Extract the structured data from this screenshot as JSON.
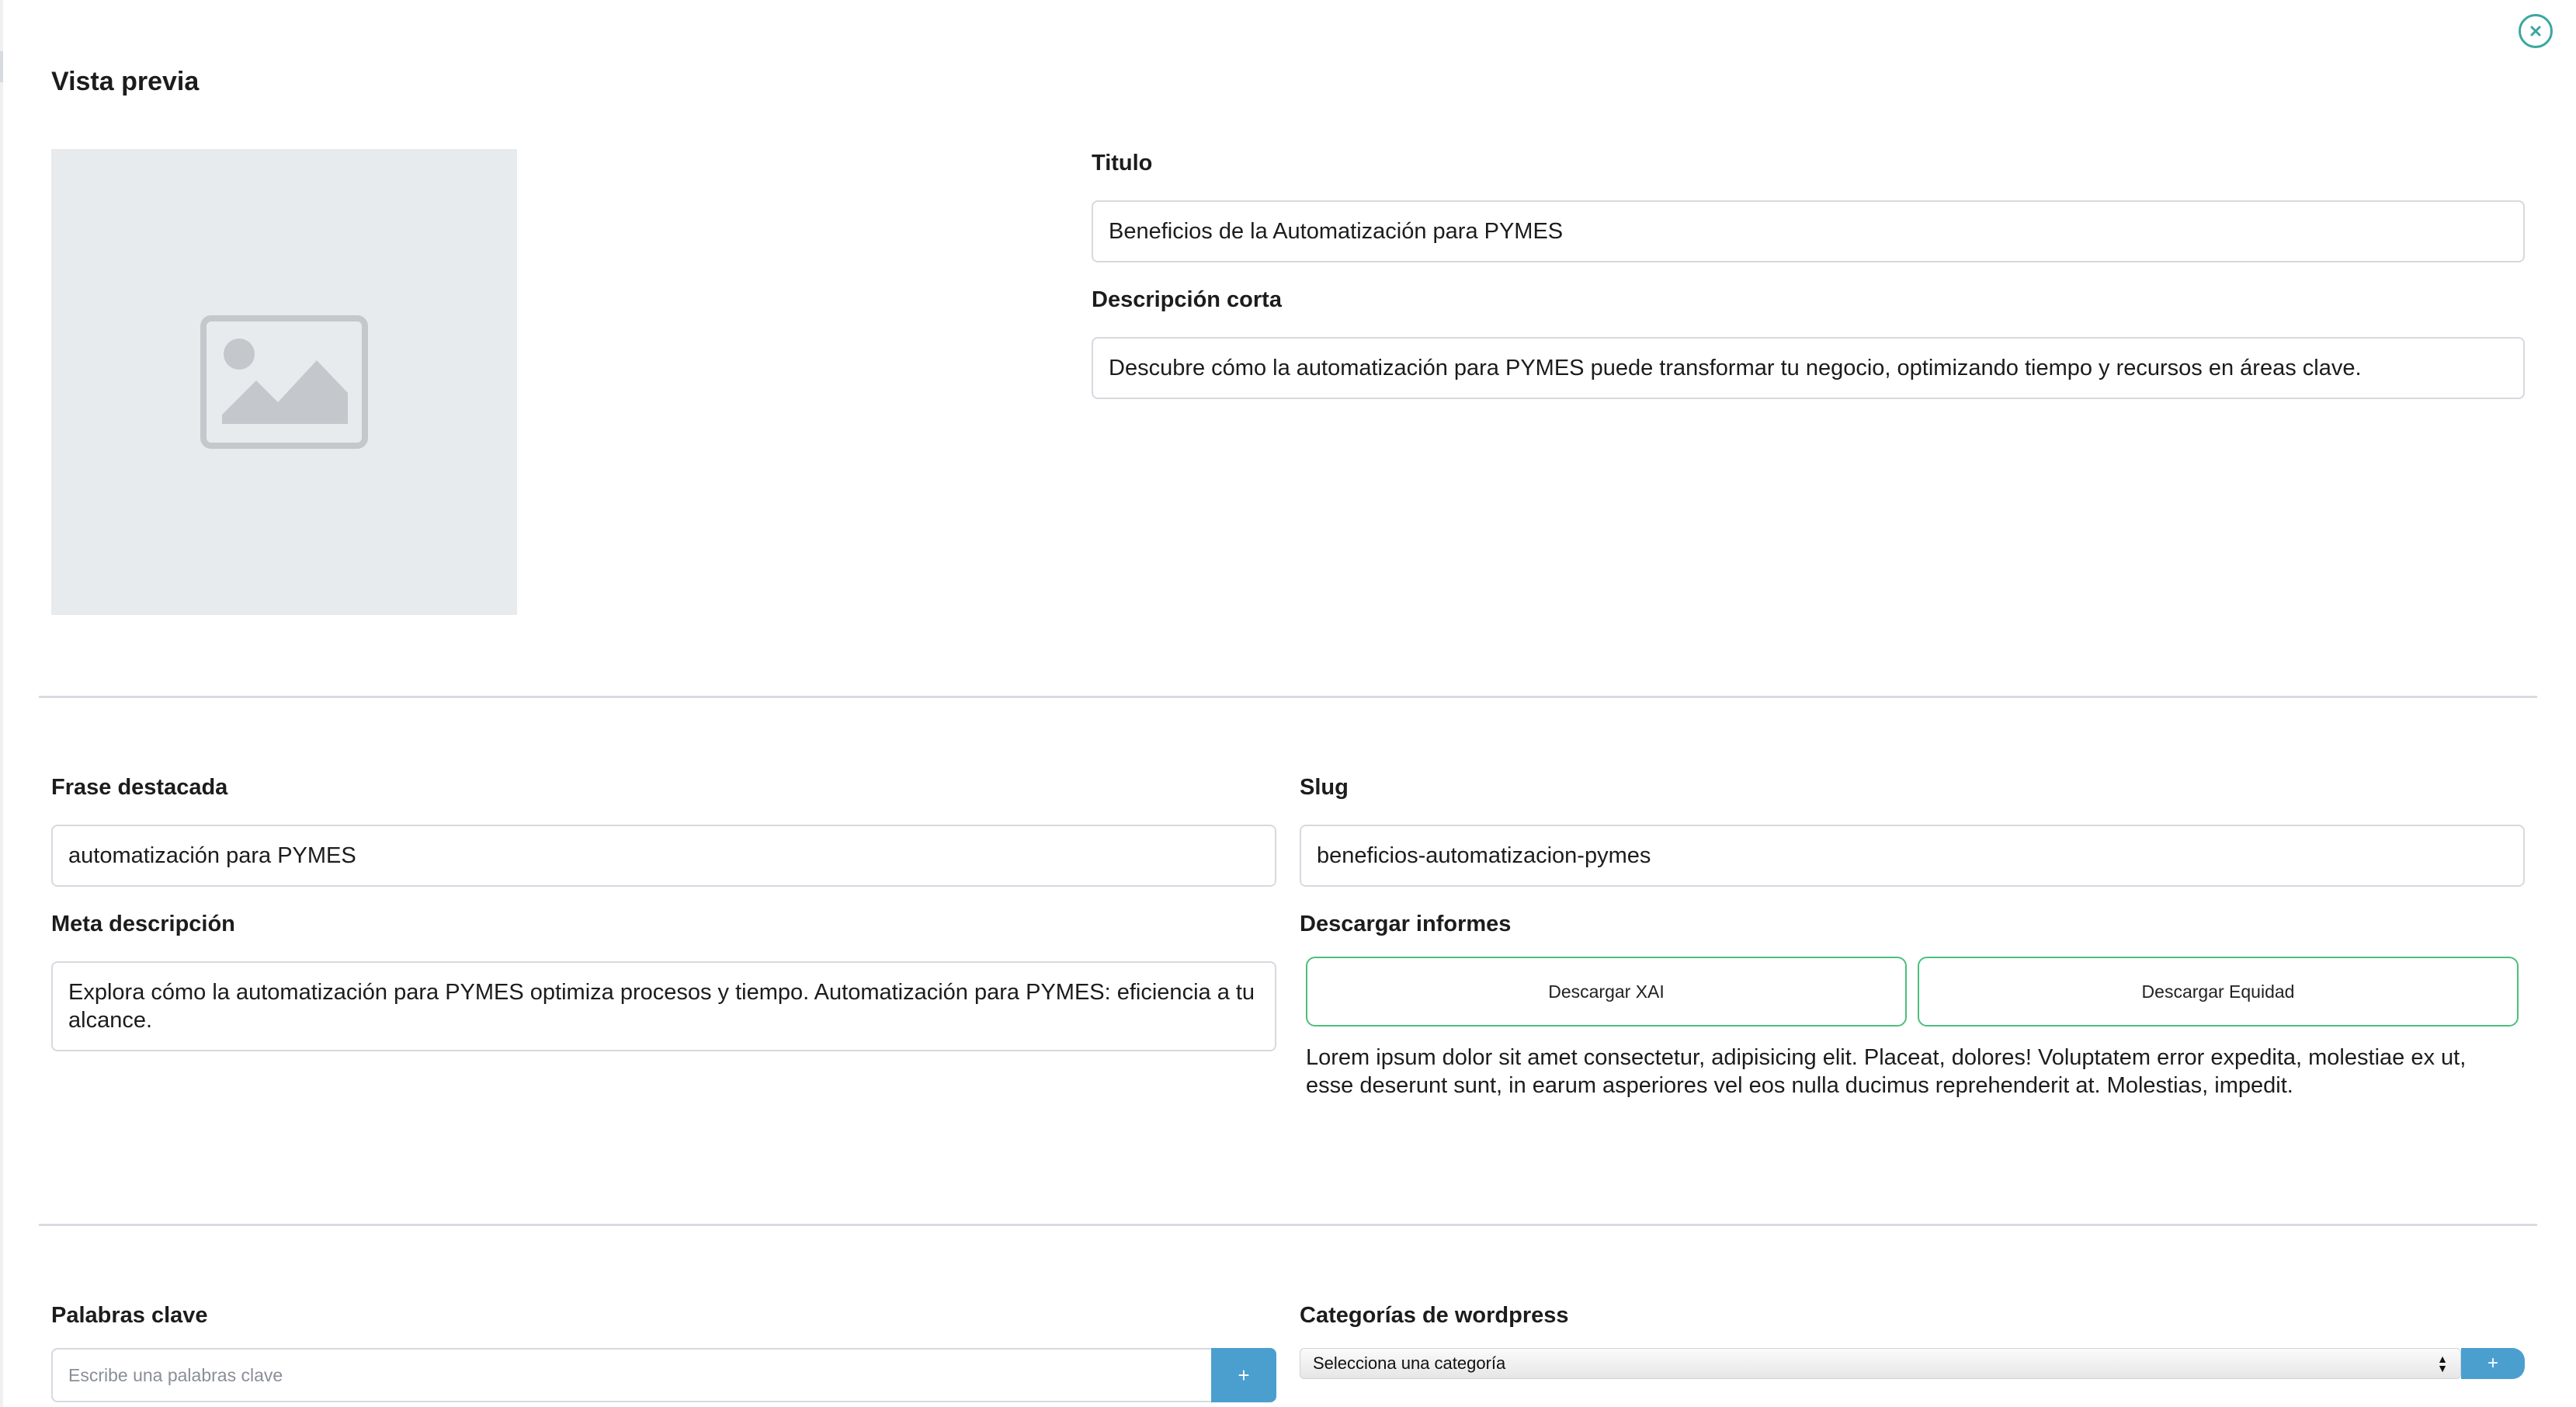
{
  "header": {
    "title": "Vista previa",
    "close_icon": "close-circle-icon"
  },
  "preview_image": {
    "icon": "image-placeholder-icon",
    "background": "#e8ebee"
  },
  "titulo": {
    "label": "Titulo",
    "value": "Beneficios de la Automatización para PYMES"
  },
  "descripcion_corta": {
    "label": "Descripción corta",
    "value": "Descubre cómo la automatización para PYMES puede transformar tu negocio, optimizando tiempo y recursos en áreas clave."
  },
  "frase_destacada": {
    "label": "Frase destacada",
    "value": "automatización para PYMES"
  },
  "slug": {
    "label": "Slug",
    "value": "beneficios-automatizacion-pymes"
  },
  "meta_descripcion": {
    "label": "Meta descripción",
    "value": "Explora cómo la automatización para PYMES optimiza procesos y tiempo. Automatización para PYMES: eficiencia a tu alcance."
  },
  "descargar_informes": {
    "label": "Descargar informes",
    "buttons": [
      "Descargar XAI",
      "Descargar Equidad"
    ],
    "text": "Lorem ipsum dolor sit amet consectetur, adipisicing elit. Placeat, dolores! Voluptatem error expedita, molestiae ex ut, esse deserunt sunt, in earum asperiores vel eos nulla ducimus reprehenderit at. Molestias, impedit."
  },
  "palabras_clave": {
    "label": "Palabras clave",
    "placeholder": "Escribe una palabras clave",
    "add_label": "+"
  },
  "categorias": {
    "label": "Categorías de wordpress",
    "selected": "Selecciona una categoría",
    "add_label": "+"
  },
  "colors": {
    "accent_teal": "#3aa7a0",
    "button_border_green": "#4cc07a",
    "add_button_blue": "#4a9fcf",
    "divider": "#d8dbe2"
  }
}
